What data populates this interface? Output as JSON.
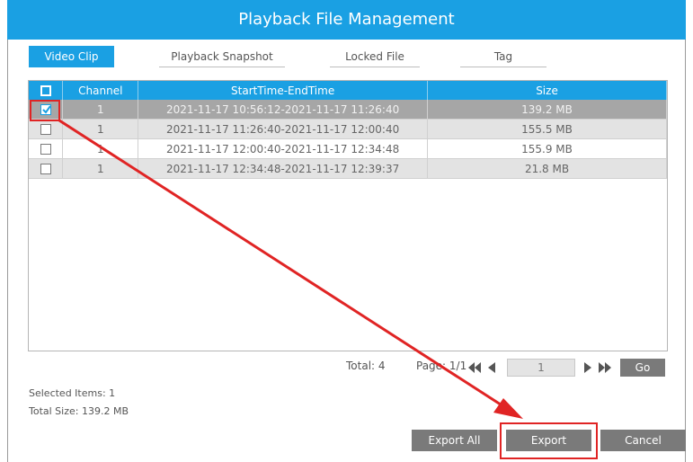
{
  "window": {
    "title": "Playback File Management"
  },
  "tabs": [
    {
      "label": "Video Clip",
      "active": true
    },
    {
      "label": "Playback Snapshot",
      "active": false
    },
    {
      "label": "Locked File",
      "active": false
    },
    {
      "label": "Tag",
      "active": false
    }
  ],
  "table": {
    "columns": [
      "Channel",
      "StartTime-EndTime",
      "Size"
    ],
    "rows": [
      {
        "checked": true,
        "channel": "1",
        "time": "2021-11-17 10:56:12-2021-11-17 11:26:40",
        "size": "139.2 MB"
      },
      {
        "checked": false,
        "channel": "1",
        "time": "2021-11-17 11:26:40-2021-11-17 12:00:40",
        "size": "155.5 MB"
      },
      {
        "checked": false,
        "channel": "1",
        "time": "2021-11-17 12:00:40-2021-11-17 12:34:48",
        "size": "155.9 MB"
      },
      {
        "checked": false,
        "channel": "1",
        "time": "2021-11-17 12:34:48-2021-11-17 12:39:37",
        "size": "21.8 MB"
      }
    ]
  },
  "pager": {
    "total_text": "Total: 4",
    "page_text": "Page: 1/1",
    "page_input": "1",
    "go_label": "Go"
  },
  "summary": {
    "selected_items": "Selected Items: 1",
    "total_size": "Total Size: 139.2 MB"
  },
  "buttons": {
    "export_all": "Export All",
    "export": "Export",
    "cancel": "Cancel"
  },
  "colors": {
    "accent": "#1aa0e3",
    "annotation": "#e02424",
    "button": "#7a7a7a"
  }
}
